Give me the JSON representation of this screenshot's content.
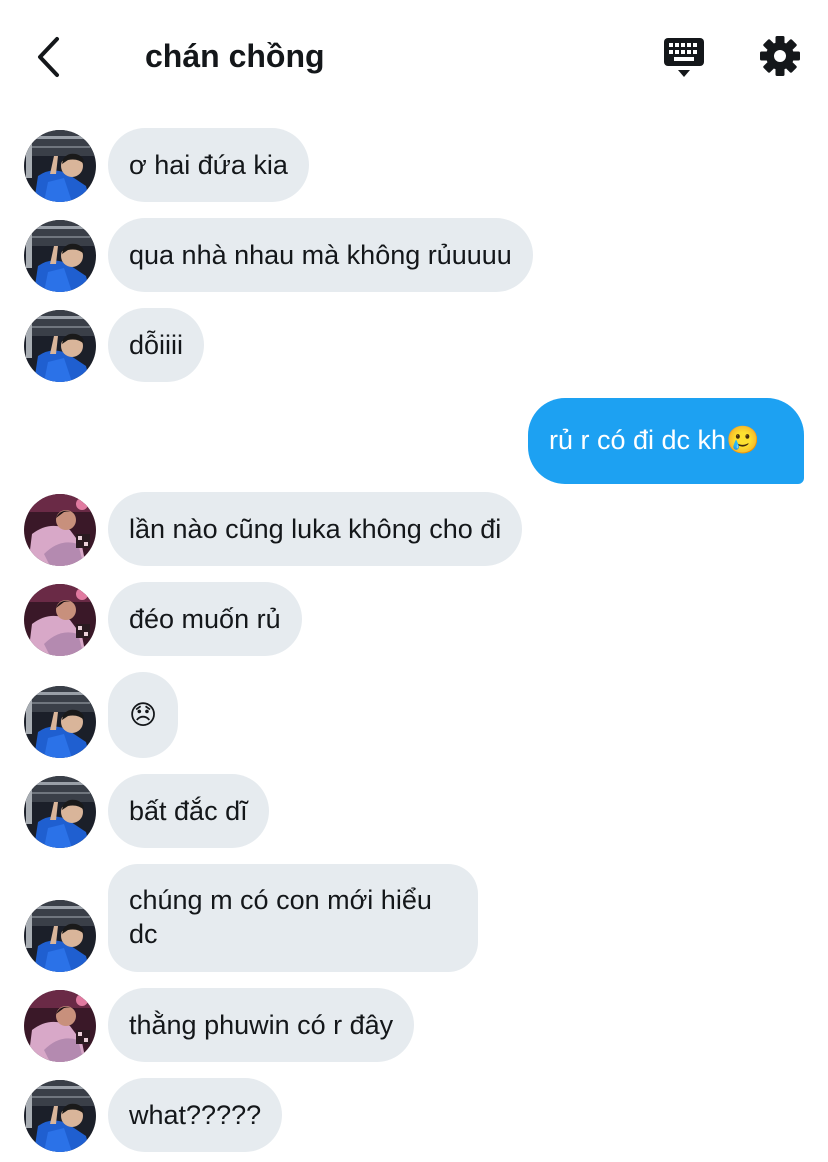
{
  "header": {
    "title": "chán chồng"
  },
  "icons": {
    "back": "chevron-left-icon",
    "keyboard": "keyboard-icon",
    "settings": "gear-icon"
  },
  "colors": {
    "incoming_bubble": "#e6ebef",
    "outgoing_bubble": "#1da1f2",
    "text": "#14171a"
  },
  "messages": [
    {
      "sender": "other",
      "avatar": "blue",
      "text": "ơ hai đứa kia"
    },
    {
      "sender": "other",
      "avatar": "blue",
      "text": "qua nhà nhau mà không rủuuuu"
    },
    {
      "sender": "other",
      "avatar": "blue",
      "text": "dỗiiii"
    },
    {
      "sender": "me",
      "text": "rủ r có đi dc kh🥲"
    },
    {
      "sender": "other",
      "avatar": "pink",
      "text": "lần nào cũng luka không cho đi"
    },
    {
      "sender": "other",
      "avatar": "pink",
      "text": "đéo muốn rủ"
    },
    {
      "sender": "other",
      "avatar": "blue",
      "text": "😞"
    },
    {
      "sender": "other",
      "avatar": "blue",
      "text": "bất đắc dĩ"
    },
    {
      "sender": "other",
      "avatar": "blue",
      "text": "chúng m có con mới hiểu dc"
    },
    {
      "sender": "other",
      "avatar": "pink",
      "text": "thằng phuwin có r đây"
    },
    {
      "sender": "other",
      "avatar": "blue",
      "text": "what?????"
    }
  ]
}
